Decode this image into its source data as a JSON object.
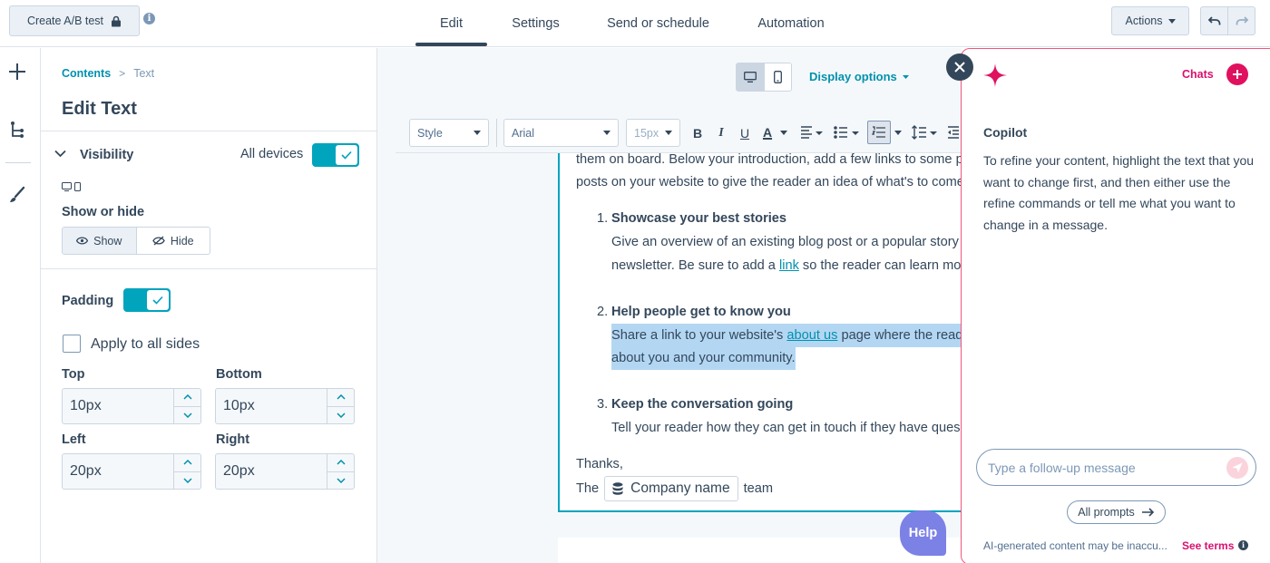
{
  "topbar": {
    "ab_test_label": "Create A/B test",
    "info_glyph": "i",
    "tabs": [
      {
        "label": "Edit",
        "active": true
      },
      {
        "label": "Settings",
        "active": false
      },
      {
        "label": "Send or schedule",
        "active": false
      },
      {
        "label": "Automation",
        "active": false
      }
    ],
    "actions_label": "Actions"
  },
  "panel": {
    "breadcrumb": {
      "root": "Contents",
      "separator": ">",
      "current": "Text"
    },
    "title": "Edit Text",
    "visibility": {
      "label": "Visibility",
      "devices_label": "All devices",
      "enabled": true
    },
    "show_or_hide": {
      "label": "Show or hide",
      "show": "Show",
      "hide": "Hide",
      "selected": "Show"
    },
    "padding": {
      "label": "Padding",
      "enabled": true
    },
    "apply_all": {
      "label": "Apply to all sides",
      "checked": false
    },
    "fields": {
      "top": {
        "label": "Top",
        "value": "10px"
      },
      "bottom": {
        "label": "Bottom",
        "value": "10px"
      },
      "left": {
        "label": "Left",
        "value": "20px"
      },
      "right": {
        "label": "Right",
        "value": "20px"
      }
    }
  },
  "canvas": {
    "display_options": "Display options",
    "toolbar": {
      "style": "Style",
      "font": "Arial",
      "size": "15px",
      "bold": "B",
      "italic": "I",
      "underline": "U",
      "color": "A"
    },
    "content": {
      "line1": "them on board. Below your introduction, add a few links to some p",
      "line2": "posts on your website to give the reader an idea of what's to come",
      "item1_num": "1.",
      "item1_title": "Showcase your best stories",
      "item1_l1": "Give an overview of an existing blog post or a popular story",
      "item1_l2_pre": "newsletter. Be sure to add a ",
      "item1_l2_link": "link",
      "item1_l2_post": " so the reader can learn mo",
      "item2_num": "2.",
      "item2_title": "Help people get to know you",
      "item2_l1_pre": "Share a link to your website's ",
      "item2_l1_link": "about us",
      "item2_l1_post": " page where the read",
      "item2_l2": "about you and your community.",
      "item3_num": "3.",
      "item3_title": "Keep the conversation going",
      "item3_l1": "Tell your reader how they can get in touch if they have ques",
      "thanks": "Thanks,",
      "sign_pre": "The",
      "token": "Company name",
      "sign_post": "team"
    },
    "help": "Help"
  },
  "copilot": {
    "chats_label": "Chats",
    "title": "Copilot",
    "message": "To refine your content, highlight the text that you want to change first, and then either use the refine commands or tell me what you want to change in a message.",
    "input_placeholder": "Type a follow-up message",
    "all_prompts": "All prompts",
    "disclaimer": "AI-generated content may be inaccu...",
    "see_terms": "See terms",
    "terms_info_glyph": "i"
  },
  "colors": {
    "accent": "#00a4bd",
    "link": "#0091ae",
    "copilot": "#e0115f",
    "text": "#33475b"
  }
}
